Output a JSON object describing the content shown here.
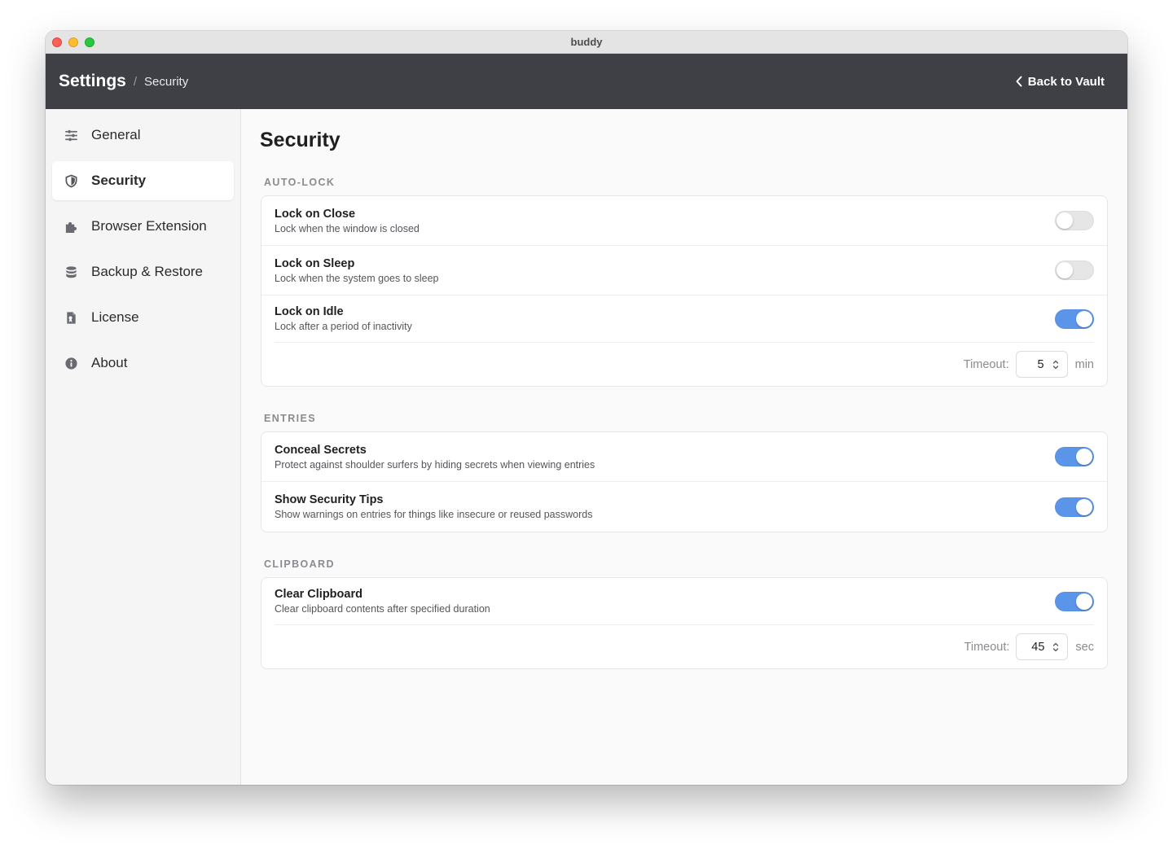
{
  "window": {
    "title": "buddy"
  },
  "header": {
    "crumb_root": "Settings",
    "crumb_separator": "/",
    "crumb_current": "Security",
    "back_label": "Back to Vault"
  },
  "sidebar": {
    "items": [
      {
        "label": "General",
        "icon": "sliders-icon",
        "active": false
      },
      {
        "label": "Security",
        "icon": "shield-icon",
        "active": true
      },
      {
        "label": "Browser Extension",
        "icon": "puzzle-icon",
        "active": false
      },
      {
        "label": "Backup & Restore",
        "icon": "database-icon",
        "active": false
      },
      {
        "label": "License",
        "icon": "certificate-file-icon",
        "active": false
      },
      {
        "label": "About",
        "icon": "info-circle-icon",
        "active": false
      }
    ]
  },
  "main": {
    "title": "Security",
    "sections": {
      "autolock": {
        "title": "AUTO-LOCK",
        "rows": [
          {
            "title": "Lock on Close",
            "desc": "Lock when the window is closed",
            "enabled": false
          },
          {
            "title": "Lock on Sleep",
            "desc": "Lock when the system goes to sleep",
            "enabled": false
          },
          {
            "title": "Lock on Idle",
            "desc": "Lock after a period of inactivity",
            "enabled": true
          }
        ],
        "timeout": {
          "label": "Timeout:",
          "value": "5",
          "unit": "min"
        }
      },
      "entries": {
        "title": "ENTRIES",
        "rows": [
          {
            "title": "Conceal Secrets",
            "desc": "Protect against shoulder surfers by hiding secrets when viewing entries",
            "enabled": true
          },
          {
            "title": "Show Security Tips",
            "desc": "Show warnings on entries for things like insecure or reused passwords",
            "enabled": true
          }
        ]
      },
      "clipboard": {
        "title": "CLIPBOARD",
        "rows": [
          {
            "title": "Clear Clipboard",
            "desc": "Clear clipboard contents after specified duration",
            "enabled": true
          }
        ],
        "timeout": {
          "label": "Timeout:",
          "value": "45",
          "unit": "sec"
        }
      }
    }
  },
  "colors": {
    "accent_toggle_on": "#5b95ea",
    "toggle_off": "#e6e6e6",
    "header_bg": "#3f4045"
  }
}
